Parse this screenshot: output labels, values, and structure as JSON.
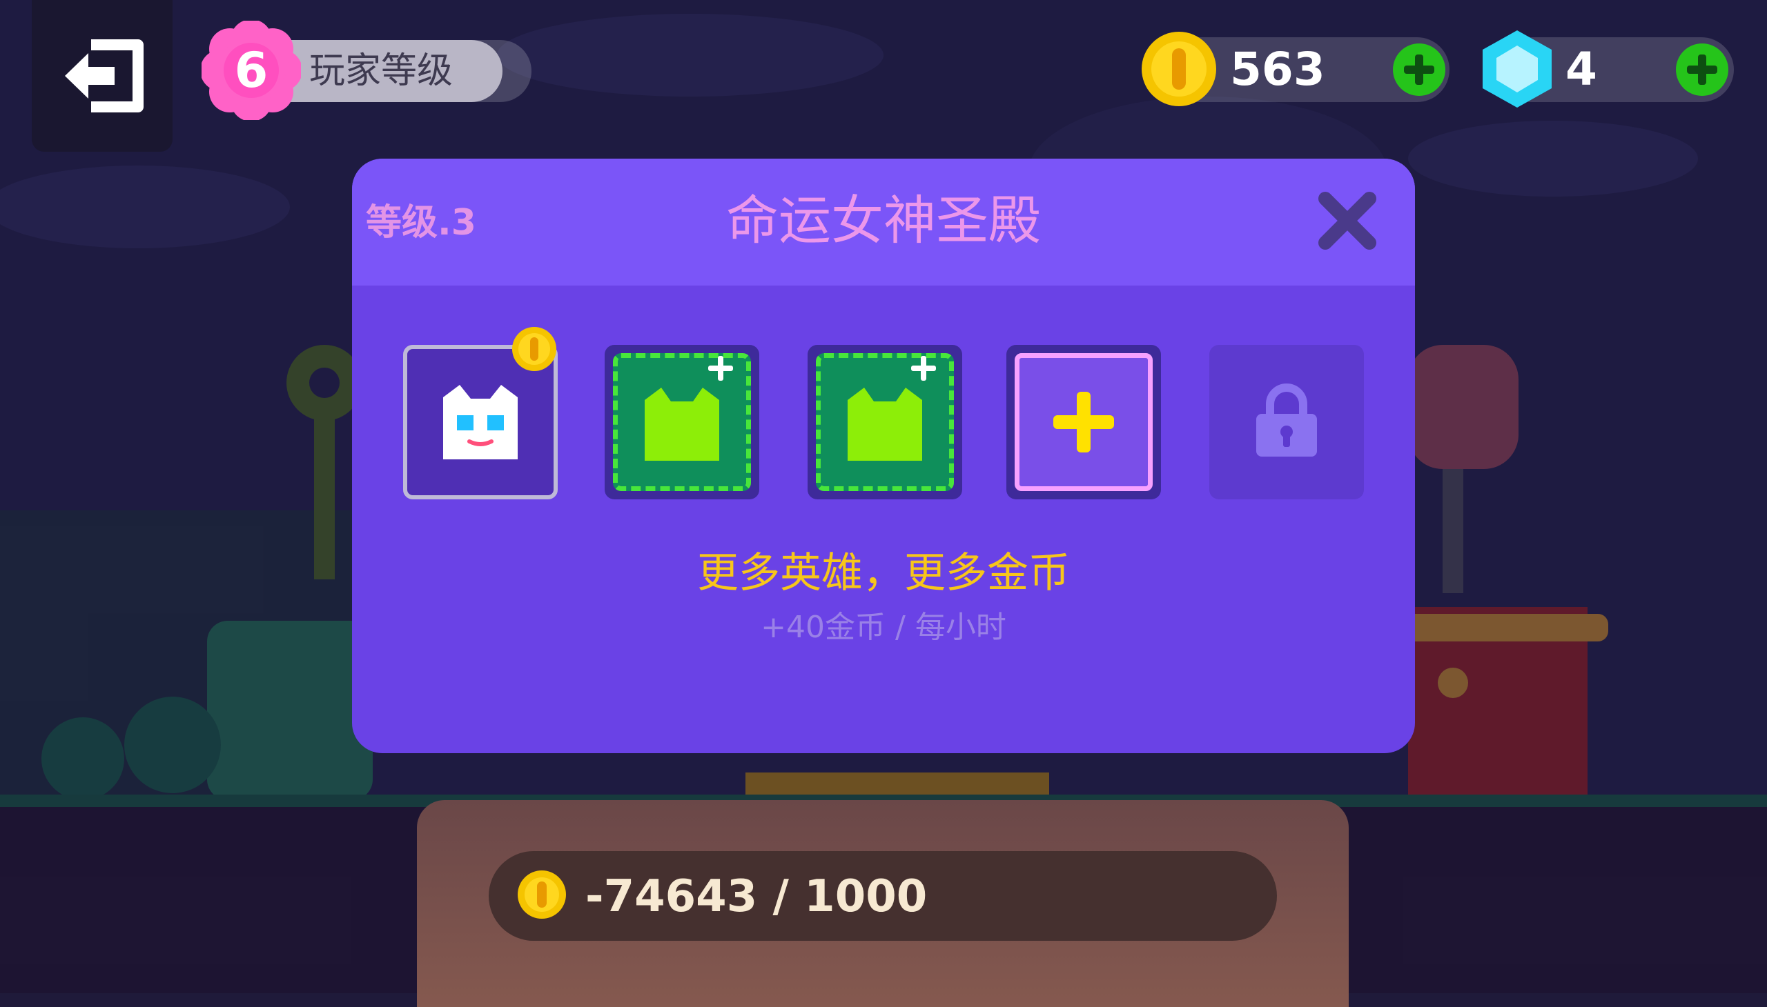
{
  "player": {
    "level": "6",
    "level_label": "玩家等级",
    "level_progress": 0.9
  },
  "resources": {
    "coins": "563",
    "gems": "4"
  },
  "modal": {
    "level_text": "等级.3",
    "title": "命运女神圣殿",
    "slots": [
      {
        "type": "hero",
        "icon": "white-cat-hero-icon"
      },
      {
        "type": "recruit",
        "icon": "green-cat-add-icon"
      },
      {
        "type": "recruit",
        "icon": "green-cat-add-icon"
      },
      {
        "type": "add",
        "icon": "plus-icon"
      },
      {
        "type": "locked",
        "icon": "lock-icon"
      }
    ],
    "promo_main": "更多英雄，更多金币",
    "promo_sub": "+40金币 / 每小时"
  },
  "upgrade": {
    "progress_text": "-74643 / 1000"
  },
  "colors": {
    "modal": "#6a42e6",
    "modal_header": "#7b55f8",
    "title": "#ec97ea",
    "promo": "#f7c61a",
    "coin": "#f5c400",
    "gem": "#29d5f5",
    "plus": "#25c41a"
  }
}
